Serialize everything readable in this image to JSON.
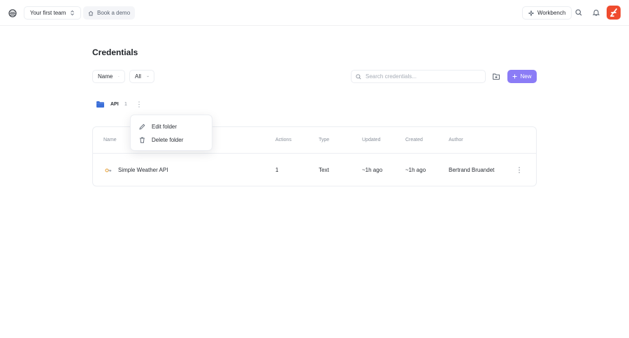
{
  "topbar": {
    "team_label": "Your first team",
    "demo_label": "Book a demo",
    "workbench_label": "Workbench"
  },
  "colors": {
    "accent": "#8b7cf6",
    "brand": "#ef4b2e",
    "folder": "#3b6fd8"
  },
  "icons": [
    "logo-icon",
    "chevron-updown-icon",
    "home-icon",
    "sparkle-icon",
    "search-icon",
    "bell-icon",
    "brand-logo-icon",
    "chevron-down-icon",
    "folder-plus-icon",
    "plus-icon",
    "folder-icon",
    "kebab-icon",
    "pencil-icon",
    "trash-icon",
    "key-icon"
  ],
  "page": {
    "title": "Credentials"
  },
  "toolbar": {
    "sort_label": "Name",
    "filter_label": "All",
    "search_placeholder": "Search credentials...",
    "new_label": "New"
  },
  "folder": {
    "name": "API",
    "count": "1"
  },
  "context_menu": {
    "items": [
      {
        "label": "Edit folder"
      },
      {
        "label": "Delete folder"
      }
    ]
  },
  "table": {
    "headers": [
      "Name",
      "Actions",
      "Type",
      "Updated",
      "Created",
      "Author"
    ],
    "rows": [
      {
        "name": "Simple Weather API",
        "actions": "1",
        "type": "Text",
        "updated": "~1h ago",
        "created": "~1h ago",
        "author": "Bertrand Bruandet"
      }
    ]
  }
}
